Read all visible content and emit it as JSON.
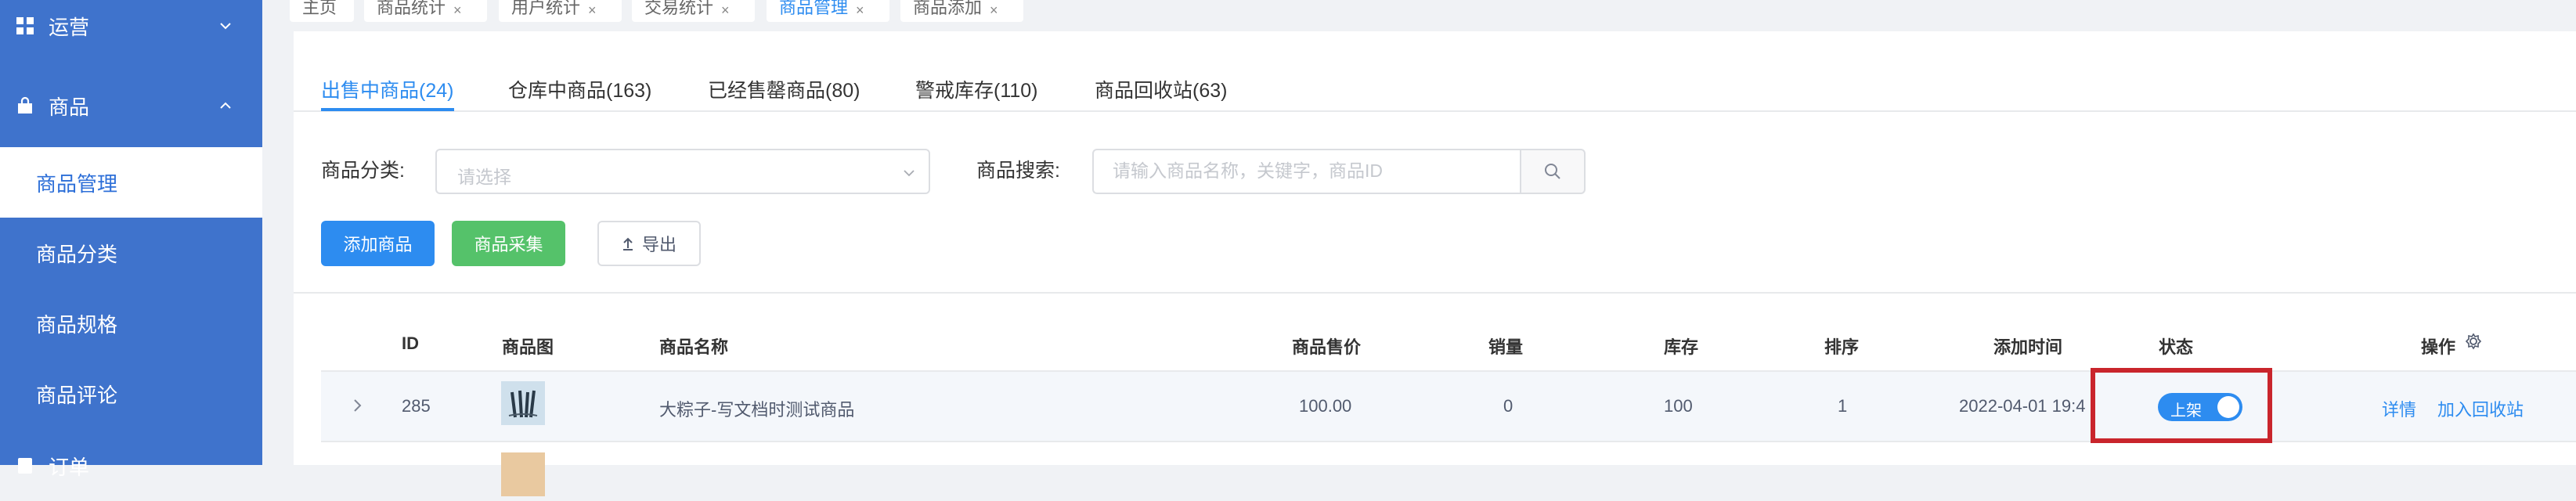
{
  "sidebar": {
    "groups": [
      {
        "label": "运营",
        "icon": "grid-icon",
        "arrow": "chevron-down"
      },
      {
        "label": "商品",
        "icon": "shopping-bag-icon",
        "arrow": "chevron-up"
      },
      {
        "label": "订单",
        "icon": "order-icon"
      }
    ],
    "items": [
      {
        "label": "商品管理",
        "active": true
      },
      {
        "label": "商品分类"
      },
      {
        "label": "商品规格"
      },
      {
        "label": "商品评论"
      }
    ]
  },
  "page_tabs": [
    {
      "label": "主页"
    },
    {
      "label": "商品统计",
      "close": "×"
    },
    {
      "label": "用户统计",
      "close": "×"
    },
    {
      "label": "交易统计",
      "close": "×"
    },
    {
      "label": "商品管理",
      "close": "×",
      "active": true
    },
    {
      "label": "商品添加",
      "close": "×"
    }
  ],
  "status_tabs": [
    {
      "label": "出售中商品(24)",
      "active": true
    },
    {
      "label": "仓库中商品(163)"
    },
    {
      "label": "已经售罄商品(80)"
    },
    {
      "label": "警戒库存(110)"
    },
    {
      "label": "商品回收站(63)"
    }
  ],
  "filters": {
    "category_label": "商品分类:",
    "category_placeholder": "请选择",
    "search_label": "商品搜索:",
    "search_placeholder": "请输入商品名称，关键字，商品ID"
  },
  "actions": {
    "add": "添加商品",
    "collect": "商品采集",
    "export": "导出"
  },
  "table": {
    "columns": [
      "ID",
      "商品图",
      "商品名称",
      "商品售价",
      "销量",
      "库存",
      "排序",
      "添加时间",
      "状态",
      "操作"
    ],
    "rows": [
      {
        "id": "285",
        "name": "大粽子-写文档时测试商品",
        "price": "100.00",
        "sales": "0",
        "stock": "100",
        "sort": "1",
        "added": "2022-04-01 19:4",
        "status_label": "上架",
        "status_on": true,
        "actions": [
          "详情",
          "加入回收站"
        ]
      }
    ]
  },
  "colors": {
    "sidebar": "#3f73cc",
    "accent": "#2d8cf0",
    "success": "#55c26a",
    "highlight": "#c9252c"
  }
}
